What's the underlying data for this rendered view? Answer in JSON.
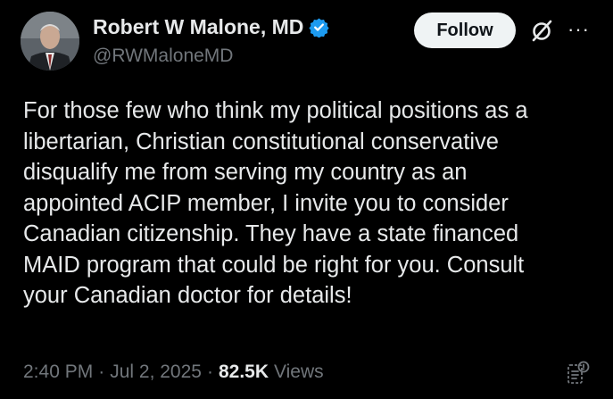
{
  "author": {
    "name": "Robert W Malone, MD",
    "handle": "@RWMaloneMD",
    "verified": true,
    "avatar": "man-in-suit-portrait"
  },
  "header": {
    "follow_label": "Follow",
    "grok_icon": "grok-slash-icon",
    "more_icon": "more-dots-icon"
  },
  "tweet": {
    "lines": [
      "For those few who think my political positions as a",
      "libertarian, Christian constitutional conservative",
      "disqualify me from serving my country as an",
      "appointed ACIP member, I invite you to consider",
      "Canadian citizenship.  They have a state financed",
      "MAID program that could be right for you.  Consult",
      "your Canadian doctor for details!"
    ]
  },
  "meta": {
    "time": "2:40 PM",
    "sep1": "·",
    "date": "Jul 2, 2025",
    "sep2": "·",
    "views_count": "82.5K",
    "views_label": "Views",
    "translate_icon": "translate-icon"
  },
  "colors": {
    "background": "#000000",
    "text": "#e7e9ea",
    "muted": "#71767b",
    "verified": "#1d9bf0",
    "button_bg": "#eff3f4"
  }
}
